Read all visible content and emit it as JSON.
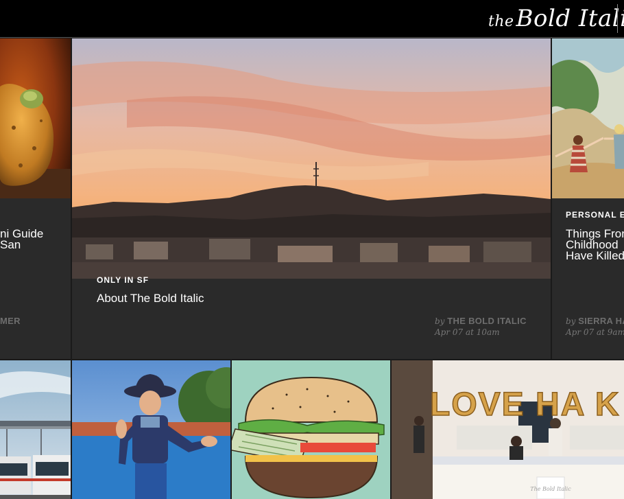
{
  "header": {
    "logo_small": "the",
    "logo_main": "Bold Italic"
  },
  "cards": {
    "left": {
      "title_line1": "ni Guide",
      "title_line2": "San",
      "author": "MER"
    },
    "main": {
      "kicker": "ONLY IN SF",
      "title": "About The Bold Italic",
      "by": "by",
      "author": "THE BOLD ITALIC",
      "date": "Apr 07 at 10am"
    },
    "right": {
      "kicker": "PERSONAL E",
      "title_line1": "Things Fron",
      "title_line2": "Childhood",
      "title_line3": "Have Killed",
      "by": "by",
      "author": "SIERRA HA",
      "date": "Apr 07 at 9am"
    }
  },
  "tiles": [
    {
      "name": "bridge-buses"
    },
    {
      "name": "cowboy-statue"
    },
    {
      "name": "hamburger-illustration"
    },
    {
      "name": "love-balloons-event",
      "balloon_text": "LOVE HA K",
      "sign_text": "The Bold Italic"
    }
  ],
  "colors": {
    "header_bg": "#000000",
    "card_bg": "#2a2a2a",
    "byline": "#777777"
  }
}
